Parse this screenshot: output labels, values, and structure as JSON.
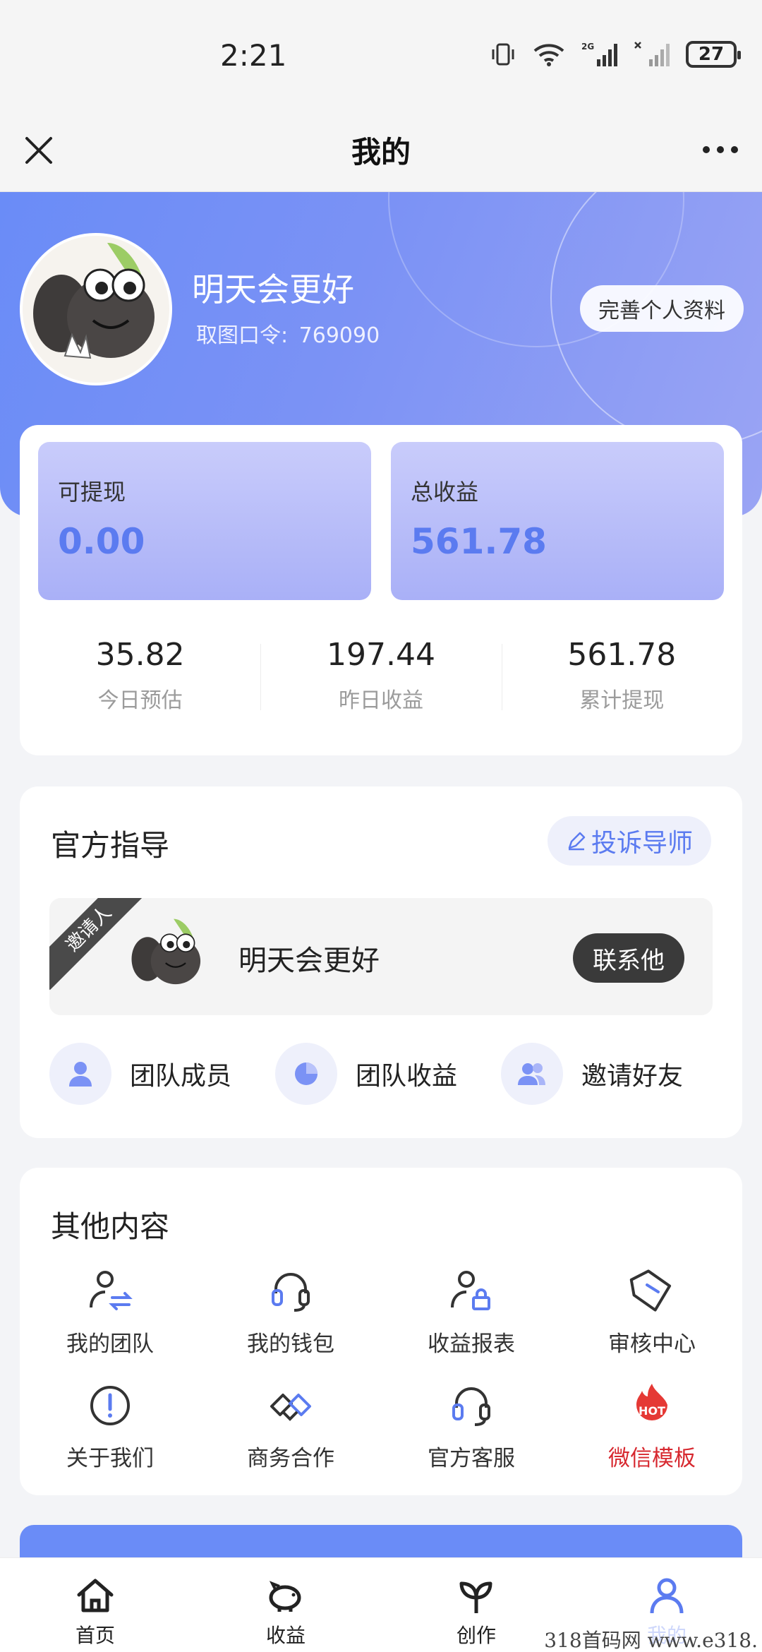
{
  "status_bar": {
    "time": "2:21",
    "battery": "27"
  },
  "nav": {
    "title": "我的"
  },
  "profile": {
    "name": "明天会更好",
    "code_label": "取图口令:",
    "code_value": "769090",
    "edit_button": "完善个人资料"
  },
  "earnings": {
    "withdrawable_label": "可提现",
    "withdrawable_value": "0.00",
    "total_label": "总收益",
    "total_value": "561.78",
    "stats": [
      {
        "value": "35.82",
        "label": "今日预估"
      },
      {
        "value": "197.44",
        "label": "昨日收益"
      },
      {
        "value": "561.78",
        "label": "累计提现"
      }
    ]
  },
  "guide": {
    "title": "官方指导",
    "complain_button": "投诉导师",
    "ribbon": "邀请人",
    "mentor_name": "明天会更好",
    "contact_button": "联系他",
    "team_items": [
      {
        "label": "团队成员",
        "icon": "user-icon"
      },
      {
        "label": "团队收益",
        "icon": "pie-chart-icon"
      },
      {
        "label": "邀请好友",
        "icon": "users-icon"
      }
    ]
  },
  "other": {
    "title": "其他内容",
    "items": [
      {
        "label": "我的团队",
        "icon": "team-transfer-icon"
      },
      {
        "label": "我的钱包",
        "icon": "headset-icon"
      },
      {
        "label": "收益报表",
        "icon": "user-lock-icon"
      },
      {
        "label": "审核中心",
        "icon": "tag-icon"
      },
      {
        "label": "关于我们",
        "icon": "info-icon"
      },
      {
        "label": "商务合作",
        "icon": "handshake-icon"
      },
      {
        "label": "官方客服",
        "icon": "headset-icon"
      },
      {
        "label": "微信模板",
        "icon": "hot-fire-icon"
      }
    ],
    "hot_badge": "HOT"
  },
  "tabbar": [
    {
      "label": "首页",
      "icon": "home-icon"
    },
    {
      "label": "收益",
      "icon": "piggy-bank-icon"
    },
    {
      "label": "创作",
      "icon": "sprout-icon"
    },
    {
      "label": "我的",
      "icon": "profile-icon"
    }
  ],
  "watermark": "318首码网 www.e318.",
  "colors": {
    "accent": "#5b7bf0",
    "hero": "#6a8cf7",
    "hot": "#d7282f"
  }
}
